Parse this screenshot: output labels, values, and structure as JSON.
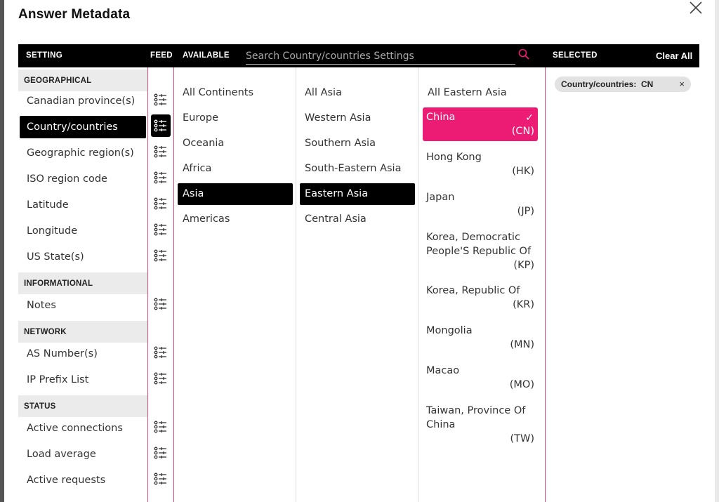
{
  "dialog": {
    "title": "Answer Metadata"
  },
  "header": {
    "setting": "SETTING",
    "feed": "FEED",
    "available": "AVAILABLE",
    "search_placeholder": "Search Country/countries Settings",
    "selected": "SELECTED",
    "clear_all": "Clear All"
  },
  "settings": {
    "groups": [
      {
        "label": "GEOGRAPHICAL"
      },
      {
        "label": "INFORMATIONAL"
      },
      {
        "label": "NETWORK"
      },
      {
        "label": "STATUS"
      }
    ],
    "items": [
      {
        "label": "Canadian province(s)"
      },
      {
        "label": "Country/countries"
      },
      {
        "label": "Geographic region(s)"
      },
      {
        "label": "ISO region code"
      },
      {
        "label": "Latitude"
      },
      {
        "label": "Longitude"
      },
      {
        "label": "US State(s)"
      },
      {
        "label": "Notes"
      },
      {
        "label": "AS Number(s)"
      },
      {
        "label": "IP Prefix List"
      },
      {
        "label": "Active connections"
      },
      {
        "label": "Load average"
      },
      {
        "label": "Active requests"
      }
    ]
  },
  "continents": [
    {
      "label": "All Continents"
    },
    {
      "label": "Europe"
    },
    {
      "label": "Oceania"
    },
    {
      "label": "Africa"
    },
    {
      "label": "Asia"
    },
    {
      "label": "Americas"
    }
  ],
  "regions": [
    {
      "label": "All Asia"
    },
    {
      "label": "Western Asia"
    },
    {
      "label": "Southern Asia"
    },
    {
      "label": "South-Eastern Asia"
    },
    {
      "label": "Eastern Asia"
    },
    {
      "label": "Central Asia"
    }
  ],
  "countries": {
    "all_label": "All Eastern Asia",
    "check": "✓",
    "items": [
      {
        "name": "China",
        "code": "(CN)"
      },
      {
        "name": "Hong Kong",
        "code": "(HK)"
      },
      {
        "name": "Japan",
        "code": "(JP)"
      },
      {
        "name": "Korea, Democratic People'S Republic Of",
        "code": "(KP)"
      },
      {
        "name": "Korea, Republic Of",
        "code": "(KR)"
      },
      {
        "name": "Mongolia",
        "code": "(MN)"
      },
      {
        "name": "Macao",
        "code": "(MO)"
      },
      {
        "name": "Taiwan, Province Of China",
        "code": "(TW)"
      }
    ]
  },
  "selected": {
    "chip_label": "Country/countries:",
    "chip_value": "CN",
    "chip_remove": "×"
  },
  "colors": {
    "accent": "#ec1c74",
    "header_bg": "#000000"
  }
}
